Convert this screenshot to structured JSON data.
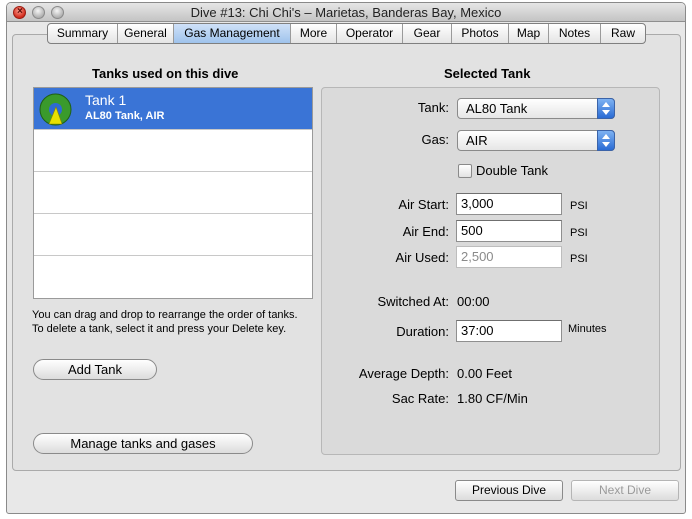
{
  "window": {
    "title": "Dive #13: Chi Chi's – Marietas, Banderas Bay, Mexico"
  },
  "tabs": [
    {
      "label": "Summary",
      "active": false
    },
    {
      "label": "General",
      "active": false
    },
    {
      "label": "Gas Management",
      "active": true
    },
    {
      "label": "More",
      "active": false
    },
    {
      "label": "Operator",
      "active": false
    },
    {
      "label": "Gear",
      "active": false
    },
    {
      "label": "Photos",
      "active": false
    },
    {
      "label": "Map",
      "active": false
    },
    {
      "label": "Notes",
      "active": false
    },
    {
      "label": "Raw",
      "active": false
    }
  ],
  "tanks_panel": {
    "heading": "Tanks used on this dive",
    "tanks": [
      {
        "name": "Tank 1",
        "description": "AL80 Tank, AIR",
        "icon": "tank-gauge-icon"
      }
    ],
    "help_text": "You can drag and drop to rearrange the order of tanks. To delete a tank, select it and press your Delete key.",
    "add_tank_label": "Add Tank",
    "manage_label": "Manage tanks and gases"
  },
  "selected_tank": {
    "heading": "Selected Tank",
    "tank_label": "Tank:",
    "tank_value": "AL80 Tank",
    "gas_label": "Gas:",
    "gas_value": "AIR",
    "double_tank_label": "Double Tank",
    "double_tank_checked": false,
    "air_start_label": "Air Start:",
    "air_start_value": "3,000",
    "air_end_label": "Air End:",
    "air_end_value": "500",
    "air_used_label": "Air Used:",
    "air_used_value": "2,500",
    "pressure_unit": "PSI",
    "switched_at_label": "Switched At:",
    "switched_at_value": "00:00",
    "duration_label": "Duration:",
    "duration_value": "37:00",
    "duration_unit": "Minutes",
    "avg_depth_label": "Average Depth:",
    "avg_depth_value": "0.00 Feet",
    "sac_rate_label": "Sac Rate:",
    "sac_rate_value": "1.80 CF/Min"
  },
  "footer": {
    "previous_label": "Previous Dive",
    "next_label": "Next Dive"
  },
  "colors": {
    "selection": "#3a74d6",
    "tab_active": "#a9c9ef",
    "tank_icon_green": "#3a9a2c",
    "tank_icon_yellow": "#e8e000"
  }
}
